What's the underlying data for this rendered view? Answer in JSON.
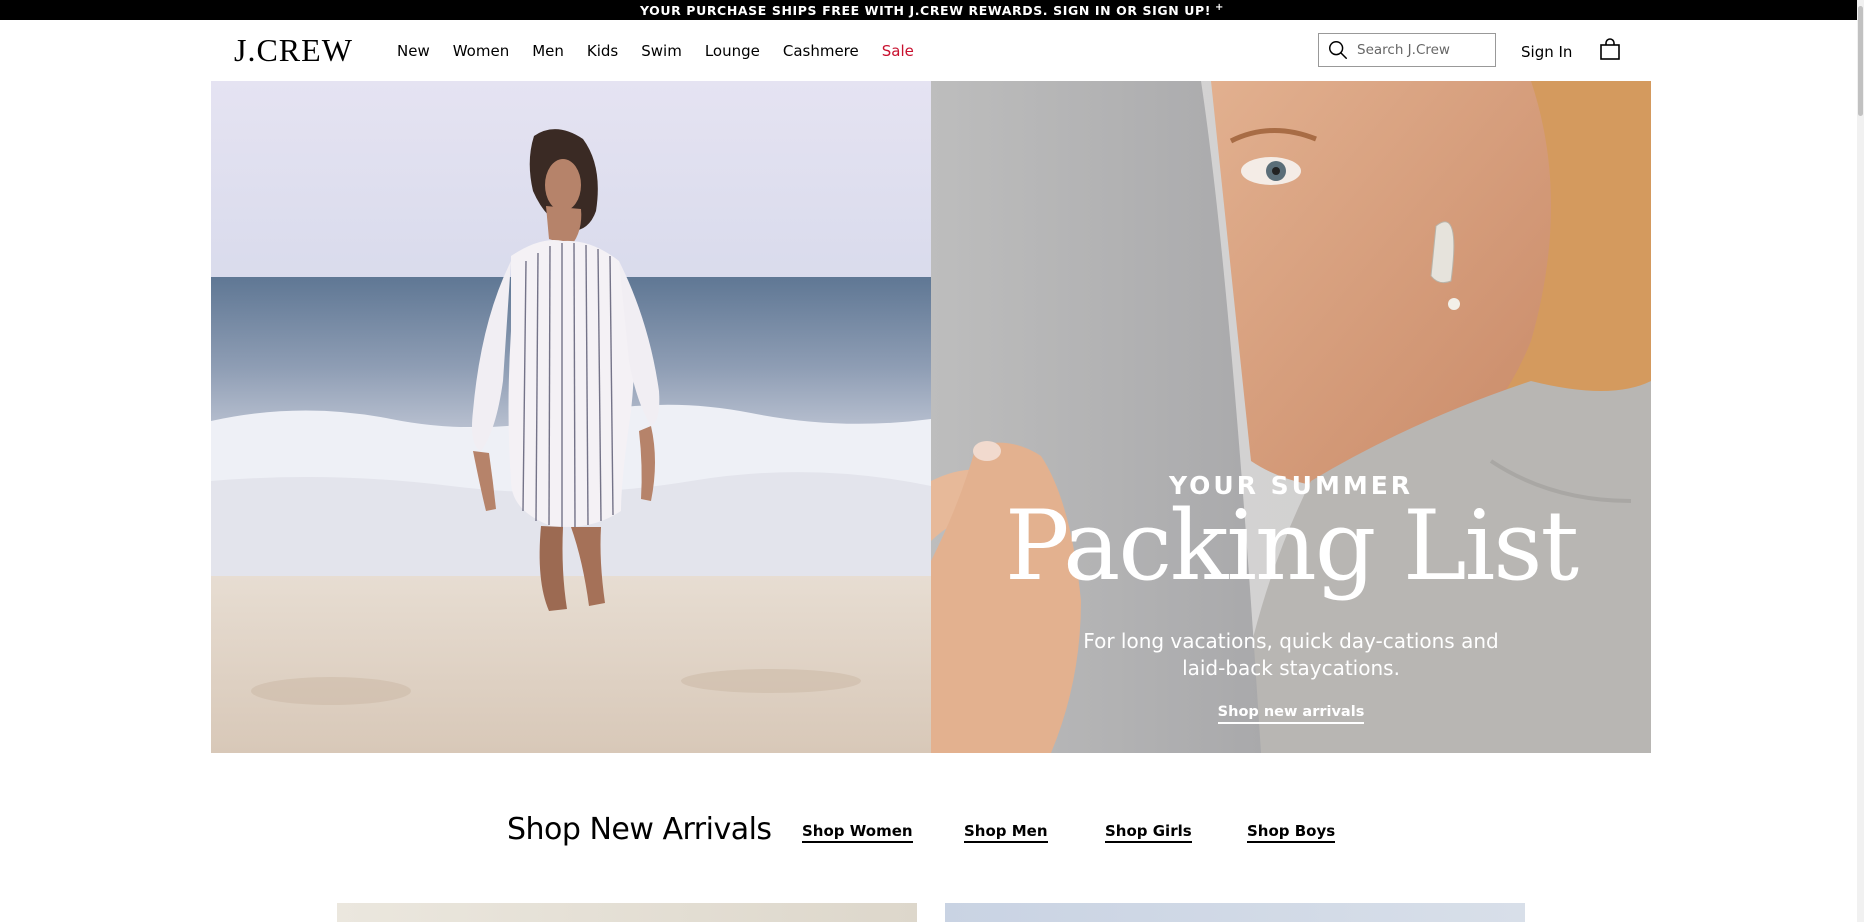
{
  "promo": {
    "text": "YOUR PURCHASE SHIPS FREE WITH J.CREW REWARDS. SIGN IN OR SIGN UP!",
    "plus": "+"
  },
  "header": {
    "logo": "J.CREW",
    "nav": [
      {
        "label": "New"
      },
      {
        "label": "Women"
      },
      {
        "label": "Men"
      },
      {
        "label": "Kids"
      },
      {
        "label": "Swim"
      },
      {
        "label": "Lounge"
      },
      {
        "label": "Cashmere"
      },
      {
        "label": "Sale",
        "color": "#c8102e"
      }
    ],
    "search": {
      "placeholder": "Search J.Crew",
      "icon": "search-icon"
    },
    "sign_in": "Sign In",
    "bag_icon": "shopping-bag-icon"
  },
  "hero": {
    "kicker": "YOUR SUMMER",
    "title": "Packing List",
    "subtitle": "For long vacations, quick day-cations and laid-back staycations.",
    "cta": "Shop new arrivals"
  },
  "arrivals": {
    "title": "Shop New Arrivals",
    "links": [
      "Shop Women",
      "Shop Men",
      "Shop Girls",
      "Shop Boys"
    ]
  }
}
